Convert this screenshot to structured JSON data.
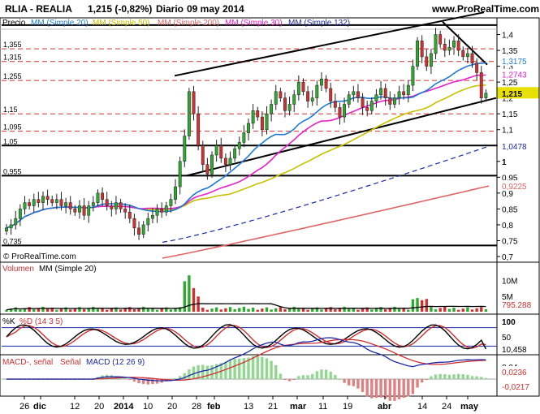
{
  "header": {
    "symbol": "RLIA - REALIA",
    "price_change": "1,215 (-0,82%)",
    "period": "Diario",
    "date": "09 may 2014",
    "site": "www.ProRealTime.com"
  },
  "legend": {
    "price": "Precio",
    "mm20": "MM (Simple 20)",
    "mm50": "MM (Simple 50)",
    "mm200": "MM (Simple 200)",
    "mm30": "MM (Simple 30)",
    "mm132": "MM (Simple 132)"
  },
  "copyright": "© ProRealTime.com",
  "colors": {
    "mm20": "#1e7bd6",
    "mm50": "#c8c000",
    "mm200": "#e06464",
    "mm30": "#e820c8",
    "mm132": "#1a2aa8",
    "up": "#2ea82e",
    "down": "#d03030"
  },
  "left_labels": [
    "1,355",
    "1,315",
    "1,255",
    "1,15",
    "1,095",
    "1,05",
    "0,955",
    "0,735"
  ],
  "right_labels": {
    "main": [
      "1,4",
      "1,35",
      "1,3",
      "1,25",
      "1,2",
      "1,15",
      "1,1",
      "1,05",
      "1",
      "0,95",
      "0,9",
      "0,85",
      "0,8",
      "0,75",
      "0,7"
    ],
    "badges": [
      {
        "text": "1,3175",
        "color": "#1e7bd6",
        "value": 1.3175
      },
      {
        "text": "1,2743",
        "color": "#e820c8",
        "value": 1.2743
      },
      {
        "text": "1,215",
        "color": "#000000",
        "value": 1.215,
        "bg": "#e8e000"
      },
      {
        "text": "1,0478",
        "color": "#1a2aa8",
        "value": 1.0478
      },
      {
        "text": "0,9225",
        "color": "#e06464",
        "value": 0.9225
      }
    ]
  },
  "volume_panel": {
    "labels": [
      "Volumen",
      "MM (Simple 20)"
    ],
    "axis": [
      "10M",
      "5M"
    ],
    "badge": "795.288"
  },
  "stoch_panel": {
    "labels": [
      "%K",
      "%D (14 3 5)"
    ],
    "axis": [
      "100",
      "50"
    ],
    "badge": "10,458"
  },
  "macd_panel": {
    "labels": [
      "MACD-, señal",
      "Señal",
      "MACD (12 26 9)"
    ],
    "axis": [
      "0,04"
    ],
    "badges": [
      "0,0236",
      "-0,0217"
    ]
  },
  "x_labels": [
    "26",
    "dic",
    "12",
    "20",
    "2014",
    "10",
    "20",
    "28",
    "feb",
    "13",
    "21",
    "mar",
    "11",
    "19",
    "abr",
    "14",
    "24",
    "may"
  ],
  "chart_data": {
    "type": "candlestick",
    "ylim": [
      0.7,
      1.45
    ],
    "closes": [
      0.79,
      0.8,
      0.82,
      0.85,
      0.87,
      0.86,
      0.88,
      0.87,
      0.89,
      0.88,
      0.87,
      0.88,
      0.86,
      0.87,
      0.85,
      0.84,
      0.86,
      0.83,
      0.86,
      0.87,
      0.9,
      0.88,
      0.86,
      0.85,
      0.87,
      0.85,
      0.84,
      0.82,
      0.79,
      0.77,
      0.8,
      0.82,
      0.83,
      0.85,
      0.84,
      0.86,
      0.88,
      0.92,
      1.0,
      1.08,
      1.22,
      1.15,
      1.05,
      0.99,
      0.96,
      1.02,
      1.05,
      1.01,
      0.99,
      1.01,
      1.04,
      1.06,
      1.09,
      1.12,
      1.16,
      1.14,
      1.1,
      1.15,
      1.18,
      1.22,
      1.2,
      1.16,
      1.18,
      1.21,
      1.25,
      1.22,
      1.19,
      1.2,
      1.24,
      1.26,
      1.23,
      1.19,
      1.17,
      1.14,
      1.18,
      1.21,
      1.22,
      1.2,
      1.17,
      1.16,
      1.19,
      1.21,
      1.23,
      1.2,
      1.18,
      1.2,
      1.22,
      1.21,
      1.24,
      1.3,
      1.38,
      1.33,
      1.3,
      1.34,
      1.4,
      1.37,
      1.35,
      1.36,
      1.38,
      1.35,
      1.33,
      1.34,
      1.31,
      1.28,
      1.2,
      1.215
    ]
  }
}
